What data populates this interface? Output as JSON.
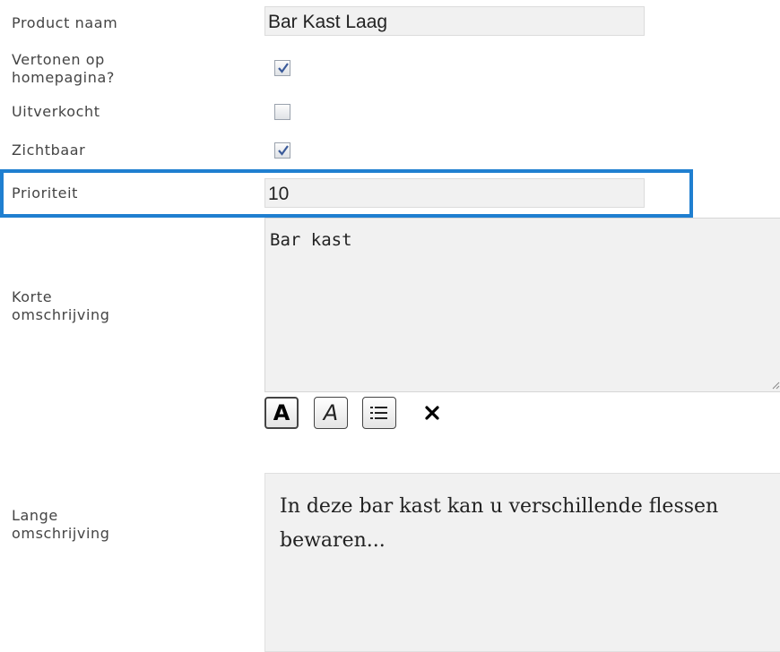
{
  "form": {
    "product_name": {
      "label": "Product naam",
      "value": "Bar Kast Laag"
    },
    "show_homepage": {
      "label": "Vertonen op\nhomepagina?",
      "checked": true
    },
    "sold_out": {
      "label": "Uitverkocht",
      "checked": false
    },
    "visible": {
      "label": "Zichtbaar",
      "checked": true
    },
    "priority": {
      "label": "Prioriteit",
      "value": "10"
    },
    "short_description": {
      "label": "Korte\nomschrijving",
      "value": "Bar kast"
    },
    "toolbar": {
      "bold": "A",
      "italic": "A",
      "bold_icon": "bold-icon",
      "italic_icon": "italic-icon",
      "list_icon": "bulleted-list-icon",
      "clear_icon": "close-icon"
    },
    "long_description": {
      "label": "Lange\nomschrijving",
      "value": "In deze bar kast kan u verschillende flessen bewaren..."
    }
  },
  "colors": {
    "focus_highlight": "#1f7fd0",
    "field_background": "#f1f1f1",
    "checkmark": "#3b5b9a"
  }
}
